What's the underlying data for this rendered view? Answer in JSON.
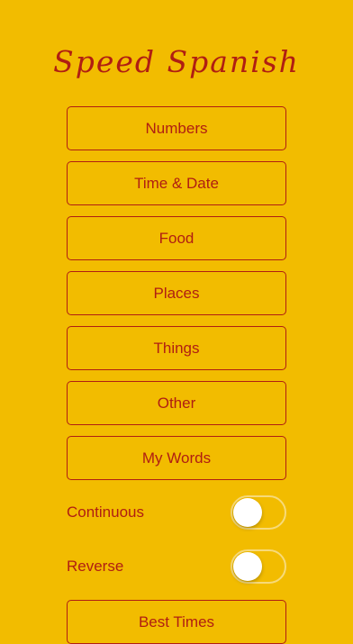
{
  "app": {
    "title": "Speed Spanish"
  },
  "menu": {
    "items": [
      {
        "label": "Numbers"
      },
      {
        "label": "Time & Date"
      },
      {
        "label": "Food"
      },
      {
        "label": "Places"
      },
      {
        "label": "Things"
      },
      {
        "label": "Other"
      },
      {
        "label": "My Words"
      }
    ]
  },
  "options": {
    "continuous": {
      "label": "Continuous",
      "on": false
    },
    "reverse": {
      "label": "Reverse",
      "on": false
    }
  },
  "bottom": {
    "best_times_label": "Best Times"
  },
  "colors": {
    "background": "#F2BC00",
    "accent": "#B01E12"
  }
}
